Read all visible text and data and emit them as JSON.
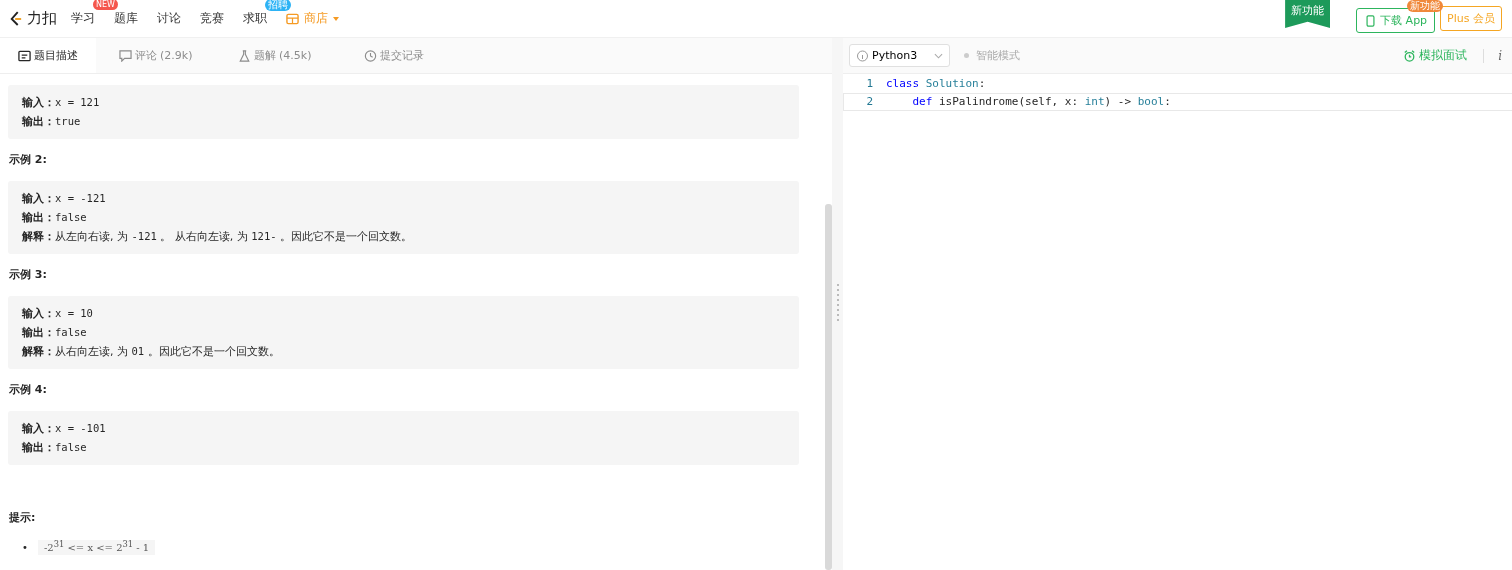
{
  "nav": {
    "logo": "力扣",
    "items": [
      {
        "label": "学习",
        "badge": "NEW",
        "kind": "link"
      },
      {
        "label": "题库",
        "kind": "link"
      },
      {
        "label": "讨论",
        "kind": "link"
      },
      {
        "label": "竞赛",
        "kind": "link"
      },
      {
        "label": "求职",
        "badge": "招聘",
        "kind": "link"
      },
      {
        "label": "商店",
        "kind": "store"
      }
    ],
    "ribbon": "新功能",
    "download": {
      "label": "下载 App",
      "badge": "新功能"
    },
    "plus": "Plus 会员"
  },
  "tabs": [
    {
      "label": "题目描述",
      "selected": true
    },
    {
      "label": "评论 (2.9k)",
      "selected": false
    },
    {
      "label": "题解 (4.5k)",
      "selected": false
    },
    {
      "label": "提交记录",
      "selected": false
    }
  ],
  "examples": [
    {
      "lines": [
        {
          "label": "输入：",
          "parts": [
            {
              "kind": "code",
              "text": "x = 121"
            }
          ]
        },
        {
          "label": "输出：",
          "parts": [
            {
              "kind": "code",
              "text": "true"
            }
          ]
        }
      ]
    },
    {
      "title": "示例 2:",
      "lines": [
        {
          "label": "输入：",
          "parts": [
            {
              "kind": "code",
              "text": "x = -121"
            }
          ]
        },
        {
          "label": "输出：",
          "parts": [
            {
              "kind": "code",
              "text": "false"
            }
          ]
        },
        {
          "label": "解释：",
          "parts": [
            {
              "kind": "text",
              "text": "从左向右读, 为 "
            },
            {
              "kind": "code",
              "text": "-121"
            },
            {
              "kind": "text",
              "text": " 。 从右向左读, 为 "
            },
            {
              "kind": "code",
              "text": "121-"
            },
            {
              "kind": "text",
              "text": " 。因此它不是一个回文数。"
            }
          ]
        }
      ]
    },
    {
      "title": "示例 3:",
      "lines": [
        {
          "label": "输入：",
          "parts": [
            {
              "kind": "code",
              "text": "x = 10"
            }
          ]
        },
        {
          "label": "输出：",
          "parts": [
            {
              "kind": "code",
              "text": "false"
            }
          ]
        },
        {
          "label": "解释：",
          "parts": [
            {
              "kind": "text",
              "text": "从右向左读, 为 "
            },
            {
              "kind": "code",
              "text": "01"
            },
            {
              "kind": "text",
              "text": " 。因此它不是一个回文数。"
            }
          ]
        }
      ]
    },
    {
      "title": "示例 4:",
      "lines": [
        {
          "label": "输入：",
          "parts": [
            {
              "kind": "code",
              "text": "x = -101"
            }
          ]
        },
        {
          "label": "输出：",
          "parts": [
            {
              "kind": "code",
              "text": "false"
            }
          ]
        }
      ]
    }
  ],
  "hints": {
    "title": "提示:",
    "bullet": "•",
    "items": [
      "-2$^{31}$  <= x <= 2$^{31}$  - 1"
    ]
  },
  "editor": {
    "language": "Python3",
    "smart_mode": "智能模式",
    "mock": "模拟面试",
    "info": "i",
    "lines": [
      {
        "number": "1",
        "tokens": [
          {
            "kind": "kw",
            "text": "class"
          },
          {
            "kind": "type",
            "text": " Solution"
          },
          {
            "kind": "plain",
            "text": ":"
          }
        ],
        "active": false
      },
      {
        "number": "2",
        "tokens": [
          {
            "kind": "kw",
            "text": "    def"
          },
          {
            "kind": "plain",
            "text": " isPalindrome(self, x: "
          },
          {
            "kind": "type",
            "text": "int"
          },
          {
            "kind": "plain",
            "text": ") -> "
          },
          {
            "kind": "type",
            "text": "bool"
          },
          {
            "kind": "plain",
            "text": ":"
          }
        ],
        "active": true
      }
    ]
  }
}
